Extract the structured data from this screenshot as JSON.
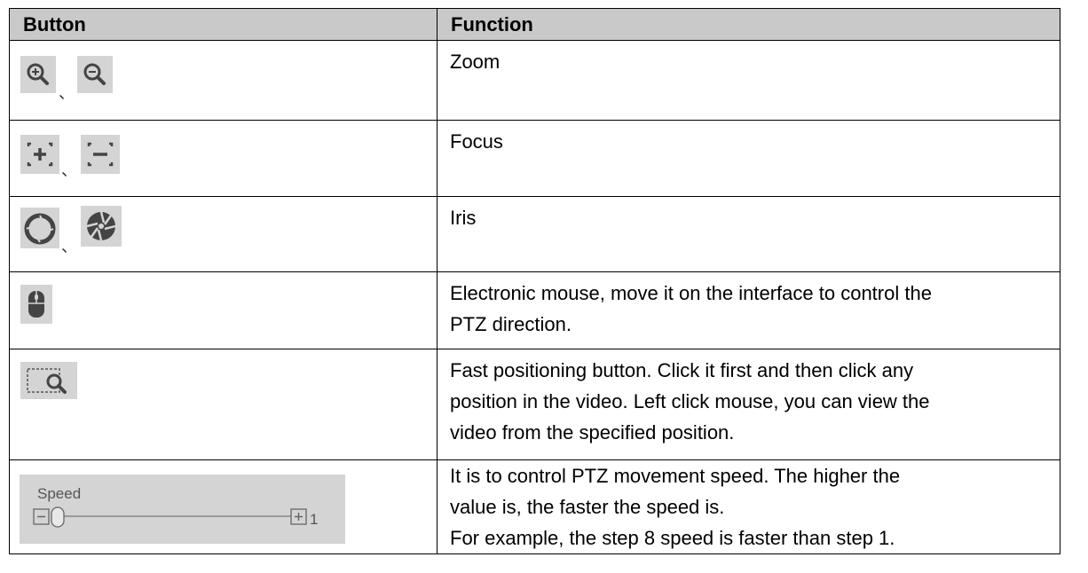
{
  "table": {
    "headers": {
      "button": "Button",
      "function": "Function"
    },
    "rows": [
      {
        "icons": [
          "zoom-in-icon",
          "zoom-out-icon"
        ],
        "separator": "、",
        "function": "Zoom"
      },
      {
        "icons": [
          "focus-near-icon",
          "focus-far-icon"
        ],
        "separator": "、",
        "function": "Focus"
      },
      {
        "icons": [
          "iris-open-icon",
          "iris-close-icon"
        ],
        "separator": "、",
        "function": "Iris"
      },
      {
        "icons": [
          "mouse-icon"
        ],
        "function_lines": [
          "Electronic mouse, move it on the interface to control the",
          "PTZ direction."
        ]
      },
      {
        "icons": [
          "fast-positioning-icon"
        ],
        "function_lines": [
          "Fast positioning button. Click it first and then click any",
          "position in the video. Left click mouse, you can view the",
          "video from the specified position."
        ]
      },
      {
        "speed_label": "Speed",
        "speed_value": "1",
        "speed_level": 1,
        "function_lines": [
          "It is to control PTZ movement speed. The higher the",
          "value is, the faster the speed is.",
          "For example, the step 8 speed is faster than step 1."
        ]
      }
    ]
  }
}
